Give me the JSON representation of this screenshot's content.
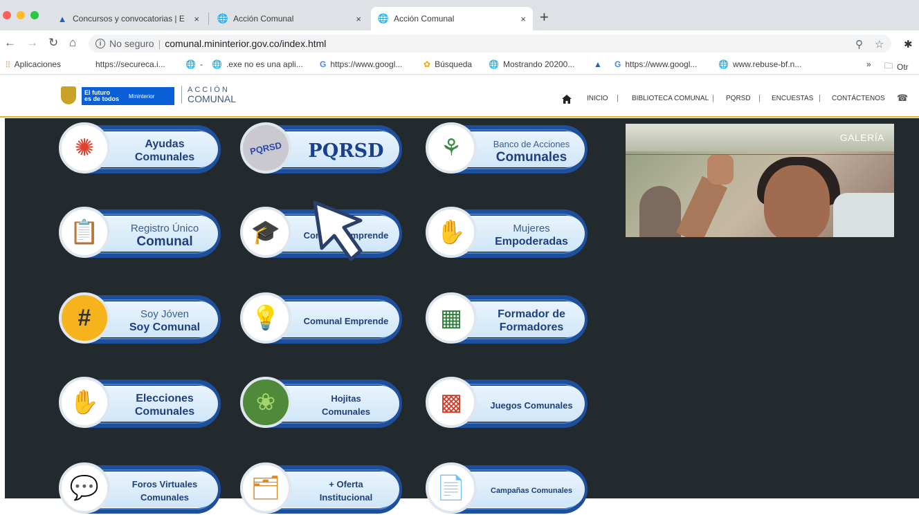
{
  "browser": {
    "tabs": [
      {
        "title": "Concursos y convocatorias | E",
        "close": "×"
      },
      {
        "title": "Acción Comunal",
        "close": "×"
      },
      {
        "title": "Acción Comunal",
        "close": "×",
        "active": true
      }
    ],
    "new_tab": "+",
    "address": {
      "security": "No seguro",
      "url": "comunal.mininterior.gov.co/index.html"
    },
    "bookmarks": [
      "Aplicaciones",
      "https://secureca.i...",
      "-",
      ".exe no es una apli...",
      "https://www.googl...",
      "Búsqueda",
      "Mostrando 20200...",
      "https://www.googl...",
      "www.rebuse-bf.n...",
      "»",
      "Otr"
    ]
  },
  "site": {
    "logo": {
      "gov_line1": "El futuro",
      "gov_line2": "es de todos",
      "ministry": "Mininterior",
      "accion": "ACCIÓN",
      "comunal": "COMUNAL"
    },
    "nav": [
      "INICIO",
      "BIBLIOTECA COMUNAL",
      "PQRSD",
      "ENCUESTAS",
      "CONTÁCTENOS"
    ],
    "nav_sep": "|"
  },
  "tiles": {
    "ayudas": {
      "l1": "Ayudas",
      "l2": "Comunales"
    },
    "pqrsd": {
      "l1": "PQRSD",
      "badge": "PQRSD"
    },
    "banco": {
      "l1": "Banco de Acciones",
      "l2": "Comunales"
    },
    "registro": {
      "l1": "Registro Único",
      "l2": "Comunal"
    },
    "emprende1": {
      "l1": "Comunal Emprende"
    },
    "mujeres": {
      "l1": "Mujeres",
      "l2": "Empoderadas"
    },
    "joven": {
      "l1": "Soy Jóven",
      "l2": "Soy Comunal"
    },
    "emprende2": {
      "l1": "Comunal Emprende"
    },
    "formador": {
      "l1": "Formador de",
      "l2": "Formadores"
    },
    "elecciones": {
      "l1": "Elecciones",
      "l2": "Comunales"
    },
    "hojitas": {
      "l1": "Hojitas",
      "l2": "Comunales"
    },
    "juegos": {
      "l1": "Juegos Comunales"
    },
    "foros": {
      "l1": "Foros Virtuales",
      "l2": "Comunales"
    },
    "oferta": {
      "l1": "+ Oferta",
      "l2": "Institucional"
    },
    "campanas": {
      "l1": "Campañas Comunales"
    }
  },
  "gallery": {
    "title": "GALERÍA"
  },
  "colors": {
    "accent": "#1e4f9c",
    "page_bg": "#232a2d",
    "header_rule": "#e8b62c"
  }
}
